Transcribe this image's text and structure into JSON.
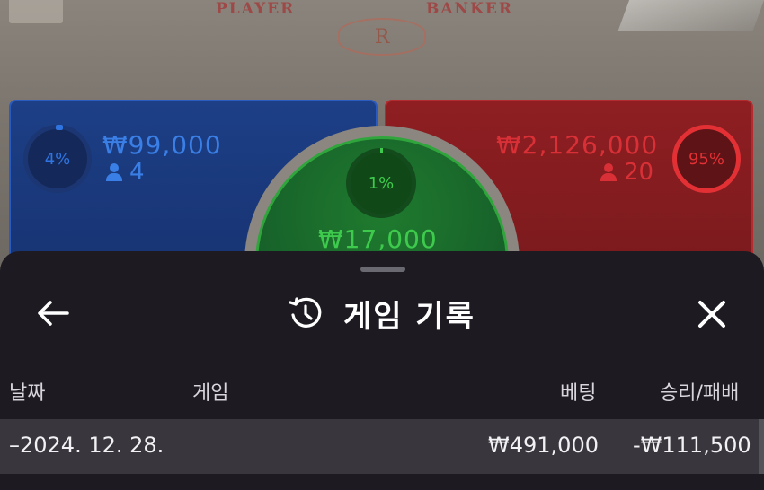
{
  "table": {
    "player_label": "PLAYER",
    "banker_label": "BANKER",
    "logo_letter": "R"
  },
  "bets": {
    "player": {
      "percent": "4%",
      "amount": "₩99,000",
      "count": "4",
      "color": "#2f74e0"
    },
    "banker": {
      "percent": "95%",
      "amount": "₩2,126,000",
      "count": "20",
      "color": "#e23035"
    },
    "tie": {
      "percent": "1%",
      "amount": "₩17,000",
      "color": "#3ecb4d"
    }
  },
  "history_sheet": {
    "title": "게임 기록",
    "icons": {
      "back": "arrow-left-icon",
      "history": "history-icon",
      "close": "close-icon"
    },
    "columns": [
      "날짜",
      "게임",
      "베팅",
      "승리/패배"
    ],
    "rows": [
      {
        "date": "–2024. 12. 28.",
        "game": "",
        "bet": "₩491,000",
        "result": "-₩111,500"
      }
    ]
  }
}
